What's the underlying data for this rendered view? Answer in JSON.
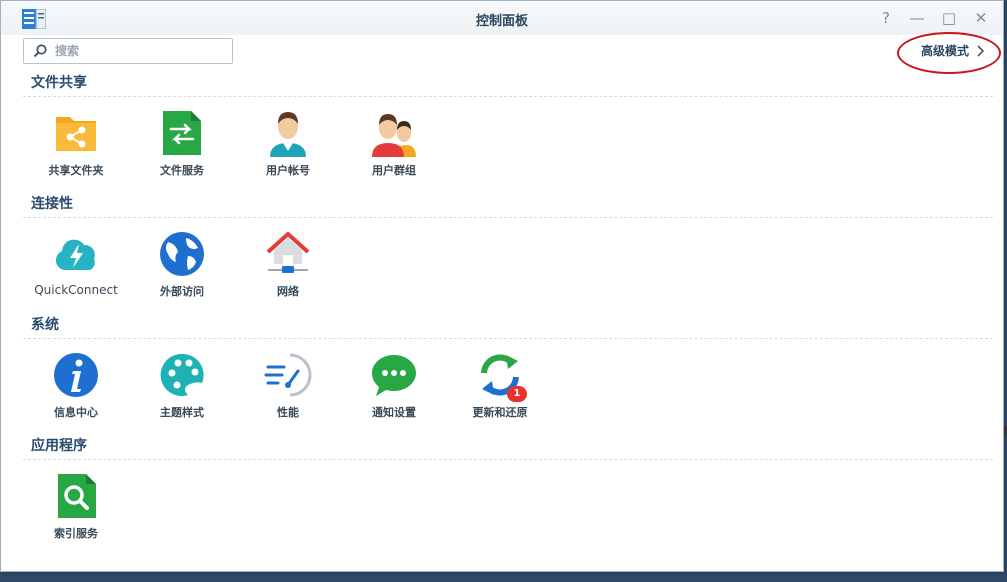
{
  "window": {
    "title": "控制面板"
  },
  "controls": {
    "help": "?",
    "minimize": "—",
    "maximize": "□",
    "close": "✕"
  },
  "search": {
    "placeholder": "搜索",
    "value": ""
  },
  "advanced_mode": {
    "label": "高级模式"
  },
  "sections": [
    {
      "title": "文件共享",
      "items": [
        {
          "label": "共享文件夹",
          "icon": "shared-folder-icon"
        },
        {
          "label": "文件服务",
          "icon": "file-services-icon"
        },
        {
          "label": "用户帐号",
          "icon": "user-icon"
        },
        {
          "label": "用户群组",
          "icon": "group-icon"
        }
      ]
    },
    {
      "title": "连接性",
      "items": [
        {
          "label": "QuickConnect",
          "icon": "quickconnect-icon"
        },
        {
          "label": "外部访问",
          "icon": "globe-icon"
        },
        {
          "label": "网络",
          "icon": "network-home-icon"
        }
      ]
    },
    {
      "title": "系统",
      "items": [
        {
          "label": "信息中心",
          "icon": "info-icon"
        },
        {
          "label": "主题样式",
          "icon": "palette-icon"
        },
        {
          "label": "性能",
          "icon": "performance-gauge-icon"
        },
        {
          "label": "通知设置",
          "icon": "chat-bubble-icon"
        },
        {
          "label": "更新和还原",
          "icon": "update-restore-icon",
          "badge": "1"
        }
      ]
    },
    {
      "title": "应用程序",
      "items": [
        {
          "label": "索引服务",
          "icon": "index-search-icon"
        }
      ]
    }
  ],
  "colors": {
    "accent_red": "#c8161c",
    "title_text": "#2a4461",
    "badge": "#e8322f"
  }
}
